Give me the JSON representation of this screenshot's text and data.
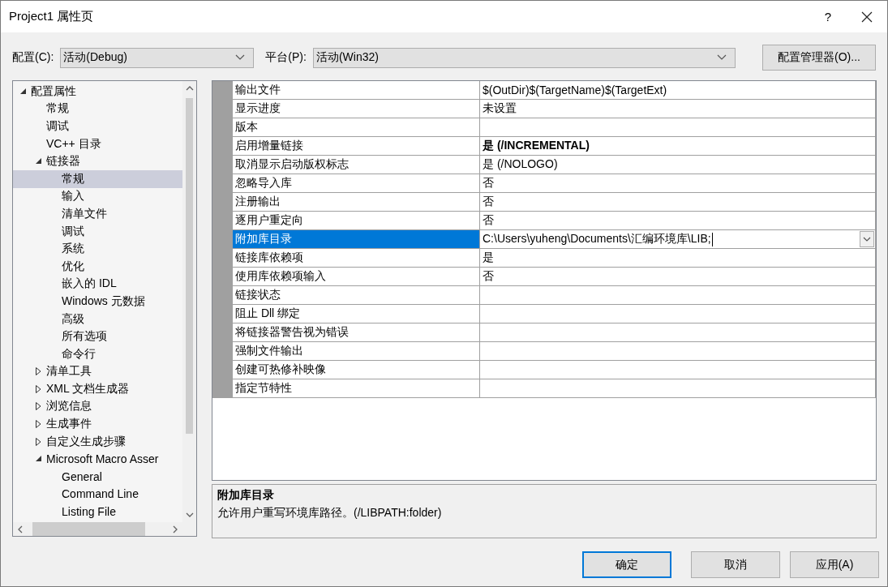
{
  "window": {
    "title": "Project1 属性页",
    "help_button": "?"
  },
  "configuration": {
    "label": "配置(C):",
    "value": "活动(Debug)"
  },
  "platform": {
    "label": "平台(P):",
    "value": "活动(Win32)"
  },
  "config_manager_button": "配置管理器(O)...",
  "tree": [
    {
      "label": "配置属性",
      "expanded": true,
      "selected": false,
      "children": [
        {
          "label": "常规",
          "selected": false
        },
        {
          "label": "调试",
          "selected": false
        },
        {
          "label": "VC++ 目录",
          "selected": false
        },
        {
          "label": "链接器",
          "expanded": true,
          "selected": false,
          "children": [
            {
              "label": "常规",
              "selected": true
            },
            {
              "label": "输入",
              "selected": false
            },
            {
              "label": "清单文件",
              "selected": false
            },
            {
              "label": "调试",
              "selected": false
            },
            {
              "label": "系统",
              "selected": false
            },
            {
              "label": "优化",
              "selected": false
            },
            {
              "label": "嵌入的 IDL",
              "selected": false
            },
            {
              "label": "Windows 元数据",
              "selected": false
            },
            {
              "label": "高级",
              "selected": false
            },
            {
              "label": "所有选项",
              "selected": false
            },
            {
              "label": "命令行",
              "selected": false
            }
          ]
        },
        {
          "label": "清单工具",
          "expanded": false,
          "selected": false
        },
        {
          "label": "XML 文档生成器",
          "expanded": false,
          "selected": false
        },
        {
          "label": "浏览信息",
          "expanded": false,
          "selected": false
        },
        {
          "label": "生成事件",
          "expanded": false,
          "selected": false
        },
        {
          "label": "自定义生成步骤",
          "expanded": false,
          "selected": false
        },
        {
          "label": "Microsoft Macro Asser",
          "expanded": true,
          "selected": false,
          "children": [
            {
              "label": "General",
              "selected": false
            },
            {
              "label": "Command Line",
              "selected": false
            },
            {
              "label": "Listing File",
              "selected": false
            }
          ]
        }
      ]
    }
  ],
  "properties": [
    {
      "name": "输出文件",
      "value": "$(OutDir)$(TargetName)$(TargetExt)",
      "modified": false,
      "selected": false
    },
    {
      "name": "显示进度",
      "value": "未设置",
      "modified": false,
      "selected": false
    },
    {
      "name": "版本",
      "modified": false,
      "selected": false
    },
    {
      "name": "启用增量链接",
      "value": "是 (/INCREMENTAL)",
      "modified": true,
      "selected": false
    },
    {
      "name": "取消显示启动版权标志",
      "value": "是 (/NOLOGO)",
      "modified": false,
      "selected": false
    },
    {
      "name": "忽略导入库",
      "value": "否",
      "modified": false,
      "selected": false
    },
    {
      "name": "注册输出",
      "value": "否",
      "modified": false,
      "selected": false
    },
    {
      "name": "逐用户重定向",
      "value": "否",
      "modified": false,
      "selected": false
    },
    {
      "name": "附加库目录",
      "value": "C:\\Users\\yuheng\\Documents\\汇编环境库\\LIB;",
      "modified": false,
      "selected": true
    },
    {
      "name": "链接库依赖项",
      "value": "是",
      "modified": false,
      "selected": false
    },
    {
      "name": "使用库依赖项输入",
      "value": "否",
      "modified": false,
      "selected": false
    },
    {
      "name": "链接状态",
      "modified": false,
      "selected": false
    },
    {
      "name": "阻止 Dll 绑定",
      "modified": false,
      "selected": false
    },
    {
      "name": "将链接器警告视为错误",
      "modified": false,
      "selected": false
    },
    {
      "name": "强制文件输出",
      "modified": false,
      "selected": false
    },
    {
      "name": "创建可热修补映像",
      "modified": false,
      "selected": false
    },
    {
      "name": "指定节特性",
      "modified": false,
      "selected": false
    }
  ],
  "description": {
    "title": "附加库目录",
    "text": "允许用户重写环境库路径。(/LIBPATH:folder)"
  },
  "buttons": [
    {
      "label": "确定",
      "default": true
    },
    {
      "label": "取消",
      "default": false
    },
    {
      "label": "应用(A)",
      "default": false
    }
  ]
}
